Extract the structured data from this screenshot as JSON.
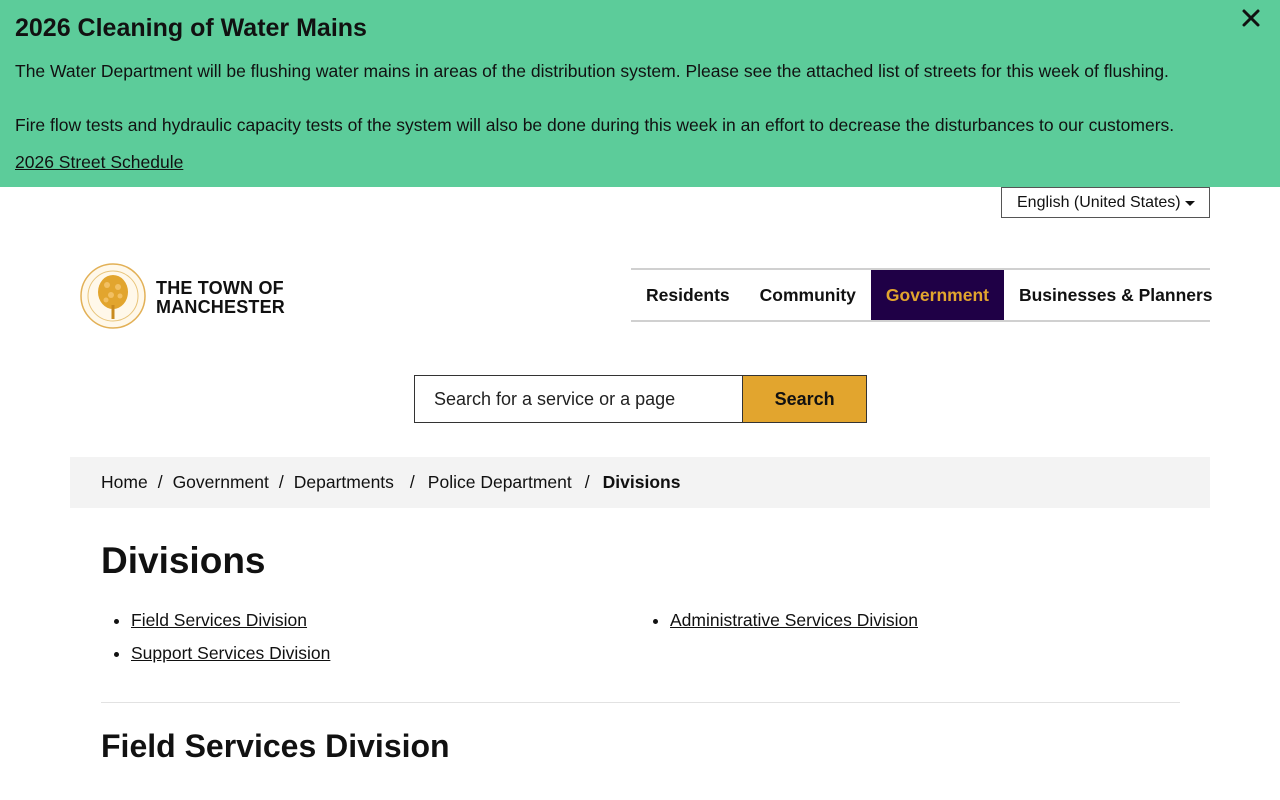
{
  "alert": {
    "title": "2026 Cleaning of Water Mains",
    "paragraph1": "The Water Department will be flushing water mains in areas of the distribution system. Please see the attached list of streets for this week of flushing.",
    "paragraph2": "Fire flow tests and hydraulic capacity tests of the system will also be done during this week in an effort to decrease the disturbances to our customers.",
    "link": "2026 Street Schedule",
    "close_icon": "close-icon",
    "bg_color": "#5ccc9a"
  },
  "language": {
    "selected": "English (United States)"
  },
  "logo": {
    "line1": "THE TOWN OF",
    "line2": "MANCHESTER",
    "icon": "town-seal-icon"
  },
  "nav": {
    "items": [
      {
        "label": "Residents"
      },
      {
        "label": "Community"
      },
      {
        "label": "Government",
        "active": true
      },
      {
        "label": "Businesses & Planners"
      }
    ],
    "active_bg": "#1f0046",
    "active_color": "#e2a52e"
  },
  "search": {
    "placeholder": "Search for a service or a page",
    "button": "Search",
    "button_color": "#e2a52e"
  },
  "breadcrumb": {
    "items": [
      "Home",
      "Government",
      "Departments",
      "Police Department"
    ],
    "current": "Divisions",
    "separator": "/"
  },
  "main": {
    "title": "Divisions",
    "divisions_left": [
      "Field Services Division",
      "Support Services Division"
    ],
    "divisions_right": [
      "Administrative Services Division"
    ],
    "section_title": "Field Services Division"
  }
}
